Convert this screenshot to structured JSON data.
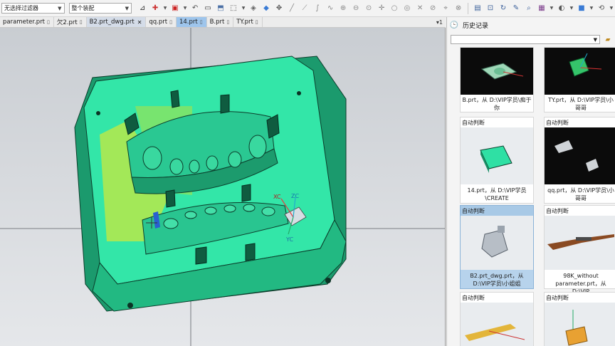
{
  "toolbar": {
    "selection_filter": "无选择过滤器",
    "scope": "整个装配"
  },
  "tabs": [
    {
      "label": "parameter.prt"
    },
    {
      "label": "欠2.prt"
    },
    {
      "label": "B2.prt_dwg.prt"
    },
    {
      "label": "qq.prt"
    },
    {
      "label": "14.prt"
    },
    {
      "label": "B.prt"
    },
    {
      "label": "TY.prt"
    }
  ],
  "tab_overflow": "1",
  "viewport": {
    "axis_xc": "XC",
    "axis_zc": "ZC",
    "axis_yc": "YC"
  },
  "panel": {
    "title": "历史记录",
    "cards": [
      {
        "header": "",
        "caption": "B.prt，从 D:\\VIP学员\\痴于你"
      },
      {
        "header": "",
        "caption": "TY.prt，从 D:\\VIP学员\\小哥哥"
      },
      {
        "header": "自动判断",
        "caption": "14.prt，从 D:\\VIP学员\\CREATE"
      },
      {
        "header": "自动判断",
        "caption": "qq.prt，从 D:\\VIP学员\\小哥哥"
      },
      {
        "header": "自动判断",
        "caption": "B2.prt_dwg.prt，从 D:\\VIP学员\\小姐姐"
      },
      {
        "header": "自动判断",
        "caption": "98K_without parameter.prt，从 D:\\VIP"
      },
      {
        "header": "自动判断",
        "caption": ""
      },
      {
        "header": "自动判断",
        "caption": ""
      }
    ]
  },
  "colors": {
    "mold_green": "#2fe0a4",
    "mold_dark": "#1a8f66",
    "selected_card": "#b7d3ec"
  }
}
